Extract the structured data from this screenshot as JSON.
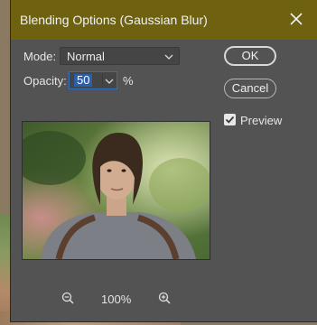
{
  "dialog": {
    "title": "Blending Options (Gaussian Blur)",
    "accent_color": "#6e6110"
  },
  "mode": {
    "label": "Mode:",
    "selected": "Normal"
  },
  "opacity": {
    "label": "Opacity:",
    "value": "50",
    "unit": "%"
  },
  "buttons": {
    "ok": "OK",
    "cancel": "Cancel"
  },
  "preview": {
    "label": "Preview",
    "checked": true
  },
  "zoom": {
    "level": "100%"
  },
  "icons": {
    "close": "close-icon",
    "zoom_out": "zoom-out-icon",
    "zoom_in": "zoom-in-icon",
    "dropdown": "chevron-down-icon",
    "check": "check-icon"
  }
}
